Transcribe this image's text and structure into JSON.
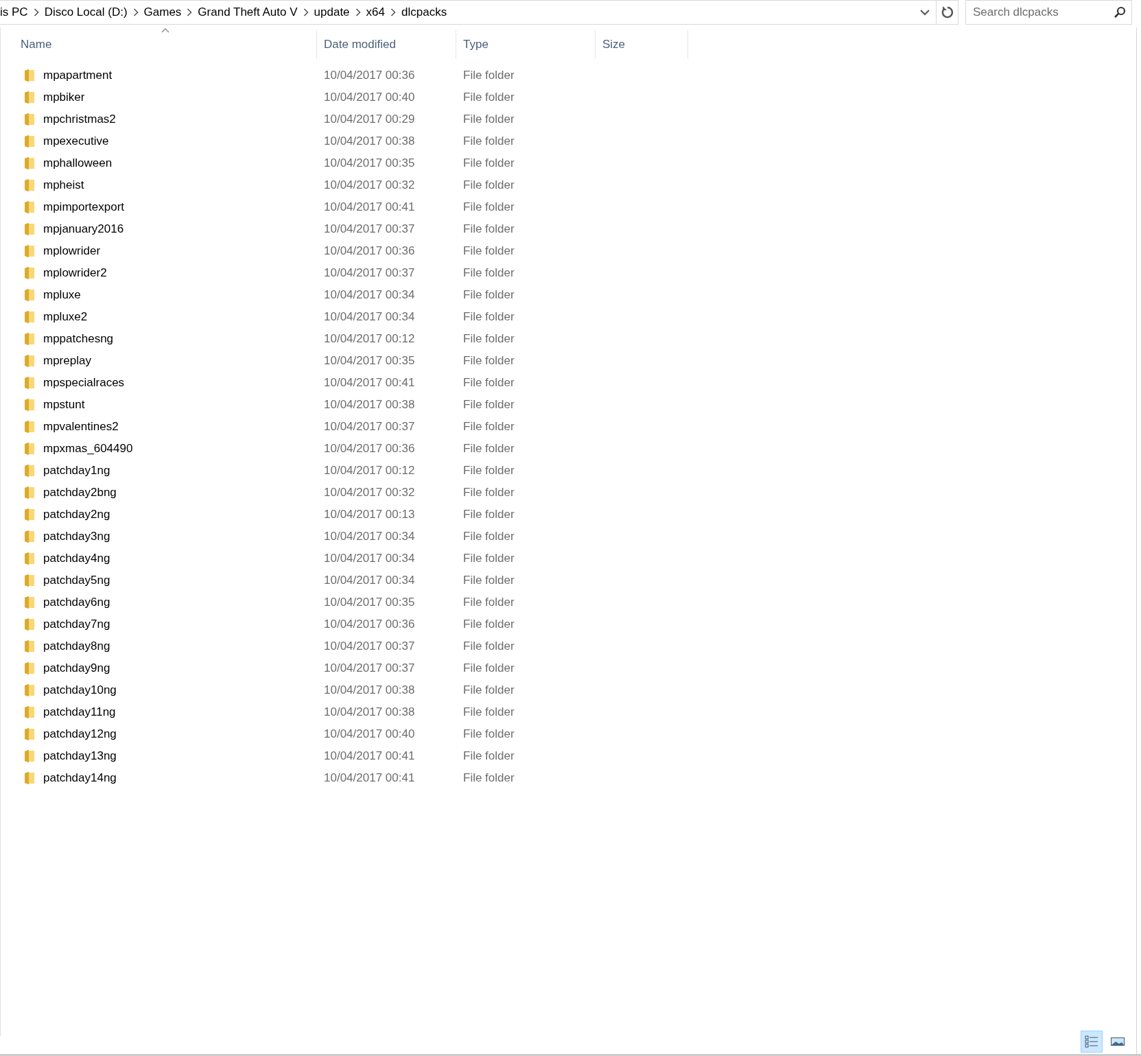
{
  "address_bar": {
    "breadcrumbs": [
      "is PC",
      "Disco Local (D:)",
      "Games",
      "Grand Theft Auto V",
      "update",
      "x64",
      "dlcpacks"
    ]
  },
  "search": {
    "placeholder": "Search dlcpacks"
  },
  "columns": [
    {
      "label": "Name",
      "sorted": true
    },
    {
      "label": "Date modified",
      "sorted": false
    },
    {
      "label": "Type",
      "sorted": false
    },
    {
      "label": "Size",
      "sorted": false
    }
  ],
  "rows": [
    {
      "name": "mpapartment",
      "date": "10/04/2017 00:36",
      "type": "File folder"
    },
    {
      "name": "mpbiker",
      "date": "10/04/2017 00:40",
      "type": "File folder"
    },
    {
      "name": "mpchristmas2",
      "date": "10/04/2017 00:29",
      "type": "File folder"
    },
    {
      "name": "mpexecutive",
      "date": "10/04/2017 00:38",
      "type": "File folder"
    },
    {
      "name": "mphalloween",
      "date": "10/04/2017 00:35",
      "type": "File folder"
    },
    {
      "name": "mpheist",
      "date": "10/04/2017 00:32",
      "type": "File folder"
    },
    {
      "name": "mpimportexport",
      "date": "10/04/2017 00:41",
      "type": "File folder"
    },
    {
      "name": "mpjanuary2016",
      "date": "10/04/2017 00:37",
      "type": "File folder"
    },
    {
      "name": "mplowrider",
      "date": "10/04/2017 00:36",
      "type": "File folder"
    },
    {
      "name": "mplowrider2",
      "date": "10/04/2017 00:37",
      "type": "File folder"
    },
    {
      "name": "mpluxe",
      "date": "10/04/2017 00:34",
      "type": "File folder"
    },
    {
      "name": "mpluxe2",
      "date": "10/04/2017 00:34",
      "type": "File folder"
    },
    {
      "name": "mppatchesng",
      "date": "10/04/2017 00:12",
      "type": "File folder"
    },
    {
      "name": "mpreplay",
      "date": "10/04/2017 00:35",
      "type": "File folder"
    },
    {
      "name": "mpspecialraces",
      "date": "10/04/2017 00:41",
      "type": "File folder"
    },
    {
      "name": "mpstunt",
      "date": "10/04/2017 00:38",
      "type": "File folder"
    },
    {
      "name": "mpvalentines2",
      "date": "10/04/2017 00:37",
      "type": "File folder"
    },
    {
      "name": "mpxmas_604490",
      "date": "10/04/2017 00:36",
      "type": "File folder"
    },
    {
      "name": "patchday1ng",
      "date": "10/04/2017 00:12",
      "type": "File folder"
    },
    {
      "name": "patchday2bng",
      "date": "10/04/2017 00:32",
      "type": "File folder"
    },
    {
      "name": "patchday2ng",
      "date": "10/04/2017 00:13",
      "type": "File folder"
    },
    {
      "name": "patchday3ng",
      "date": "10/04/2017 00:34",
      "type": "File folder"
    },
    {
      "name": "patchday4ng",
      "date": "10/04/2017 00:34",
      "type": "File folder"
    },
    {
      "name": "patchday5ng",
      "date": "10/04/2017 00:34",
      "type": "File folder"
    },
    {
      "name": "patchday6ng",
      "date": "10/04/2017 00:35",
      "type": "File folder"
    },
    {
      "name": "patchday7ng",
      "date": "10/04/2017 00:36",
      "type": "File folder"
    },
    {
      "name": "patchday8ng",
      "date": "10/04/2017 00:37",
      "type": "File folder"
    },
    {
      "name": "patchday9ng",
      "date": "10/04/2017 00:37",
      "type": "File folder"
    },
    {
      "name": "patchday10ng",
      "date": "10/04/2017 00:38",
      "type": "File folder"
    },
    {
      "name": "patchday11ng",
      "date": "10/04/2017 00:38",
      "type": "File folder"
    },
    {
      "name": "patchday12ng",
      "date": "10/04/2017 00:40",
      "type": "File folder"
    },
    {
      "name": "patchday13ng",
      "date": "10/04/2017 00:41",
      "type": "File folder"
    },
    {
      "name": "patchday14ng",
      "date": "10/04/2017 00:41",
      "type": "File folder"
    }
  ],
  "view_buttons": [
    {
      "kind": "details",
      "selected": true
    },
    {
      "kind": "large_icons",
      "selected": false
    }
  ]
}
